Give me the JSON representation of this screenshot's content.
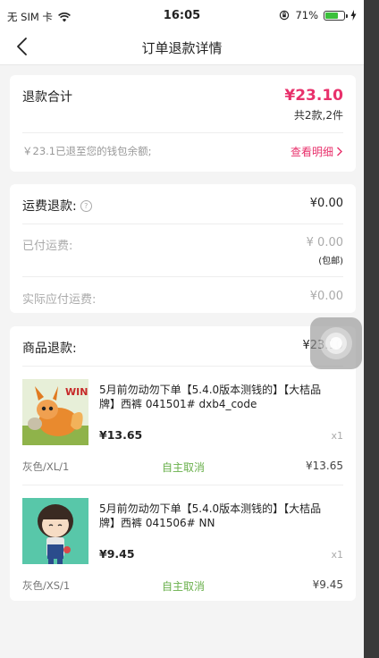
{
  "status_bar": {
    "carrier": "无 SIM 卡",
    "time": "16:05",
    "battery_percent": "71%",
    "battery_level": 0.71
  },
  "nav": {
    "title": "订单退款详情"
  },
  "summary": {
    "label": "退款合计",
    "amount": "¥23.10",
    "count": "共2款,2件",
    "note": "￥23.1已退至您的钱包余额;",
    "detail_link": "查看明细"
  },
  "shipping": {
    "label": "运费退款:",
    "value": "¥0.00",
    "paid_label": "已付运费:",
    "paid_value": "¥ 0.00",
    "paid_tag": "(包邮)",
    "actual_label": "实际应付运费:",
    "actual_value": "¥0.00"
  },
  "goods": {
    "label": "商品退款:",
    "value": "¥23.10",
    "items": [
      {
        "title": "5月前勿动勿下单【5.4.0版本测钱的】【大桔品牌】西裤  041501#  dxb4_code",
        "price": "¥13.65",
        "qty": "x1",
        "spec": "灰色/XL/1",
        "status": "自主取消",
        "refund": "¥13.65",
        "thumb_text": "WIN!"
      },
      {
        "title": "5月前勿动勿下单【5.4.0版本测钱的】【大桔品牌】西裤  041506#  NN",
        "price": "¥9.45",
        "qty": "x1",
        "spec": "灰色/XS/1",
        "status": "自主取消",
        "refund": "¥9.45"
      }
    ]
  },
  "colors": {
    "accent": "#e8306b",
    "status_green": "#6ab04c",
    "battery_green": "#3bc03b"
  }
}
